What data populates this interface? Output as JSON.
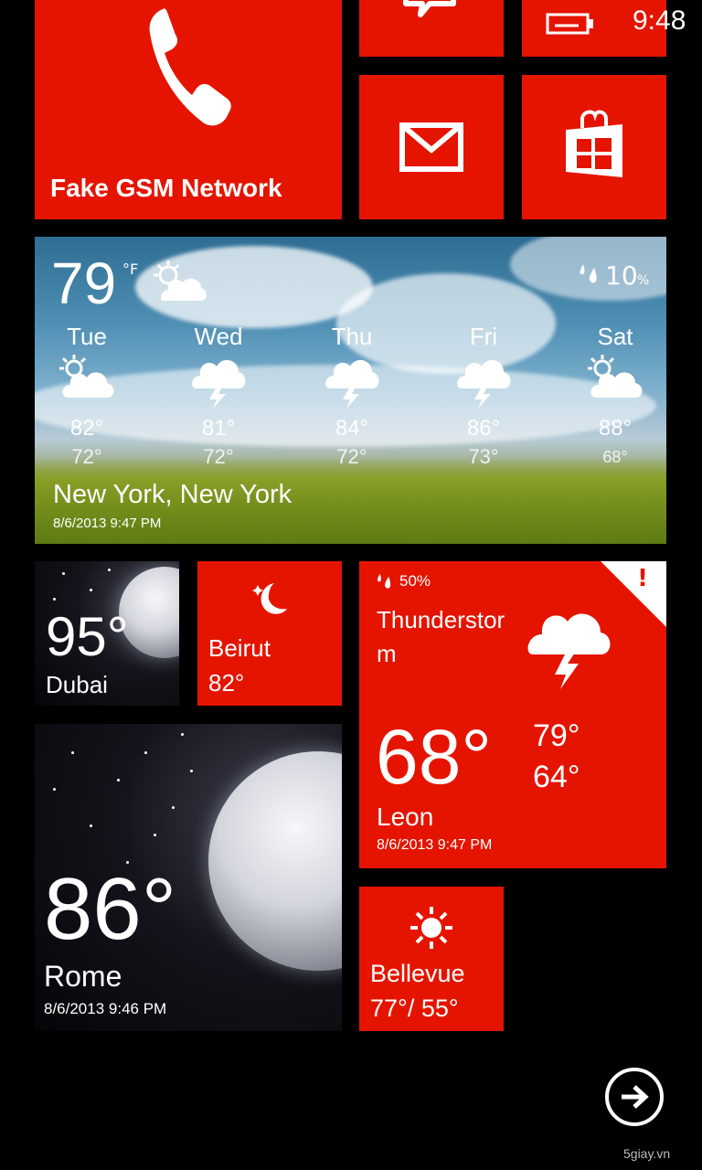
{
  "status": {
    "time": "9:48"
  },
  "phone_tile": {
    "label": "Fake GSM Network"
  },
  "weather_main": {
    "temp": "79",
    "unit": "°F",
    "precip": "10",
    "precip_unit": "%",
    "location": "New York, New York",
    "updated": "8/6/2013 9:47 PM",
    "forecast": [
      {
        "day": "Tue",
        "high": "82°",
        "low": "72°",
        "icon": "partly-cloudy-icon"
      },
      {
        "day": "Wed",
        "high": "81°",
        "low": "72°",
        "icon": "thunderstorm-icon"
      },
      {
        "day": "Thu",
        "high": "84°",
        "low": "72°",
        "icon": "thunderstorm-icon"
      },
      {
        "day": "Fri",
        "high": "86°",
        "low": "73°",
        "icon": "thunderstorm-icon"
      },
      {
        "day": "Sat",
        "high": "88°",
        "low": "68°",
        "icon": "partly-cloudy-icon"
      }
    ]
  },
  "dubai_tile": {
    "temp": "95°",
    "city": "Dubai"
  },
  "beirut_tile": {
    "city": "Beirut",
    "temp": "82°"
  },
  "leon_tile": {
    "precip": "50%",
    "alert": "!",
    "condition": "Thunderstorm",
    "temp": "68°",
    "high": "79°",
    "low": "64°",
    "city": "Leon",
    "updated": "8/6/2013 9:47 PM"
  },
  "rome_tile": {
    "temp": "86°",
    "city": "Rome",
    "updated": "8/6/2013 9:46 PM"
  },
  "bellevue_tile": {
    "city": "Bellevue",
    "temps": "77°/ 55°"
  },
  "watermark": "5giay.vn",
  "colors": {
    "accent": "#e51400",
    "background": "#000000"
  }
}
